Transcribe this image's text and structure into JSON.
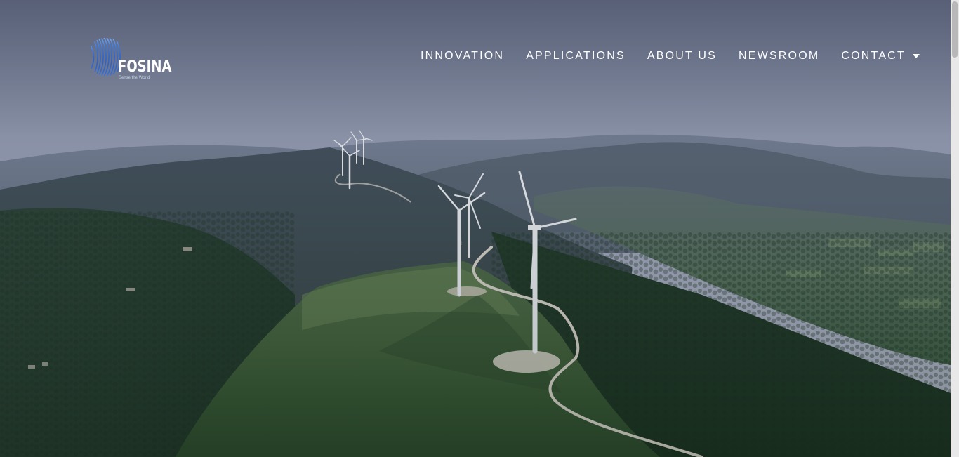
{
  "brand": {
    "name": "FOSINA",
    "tagline": "Sense the World",
    "accent": "#2f6fd6"
  },
  "nav": {
    "items": [
      {
        "label": "INNOVATION"
      },
      {
        "label": "APPLICATIONS"
      },
      {
        "label": "ABOUT US"
      },
      {
        "label": "NEWSROOM"
      },
      {
        "label": "CONTACT",
        "has_dropdown": true
      }
    ]
  },
  "hero": {
    "image": "aerial-wind-farm-hills"
  },
  "icons": {
    "logo": "fosina-logo-icon",
    "dropdown": "caret-down-icon"
  }
}
